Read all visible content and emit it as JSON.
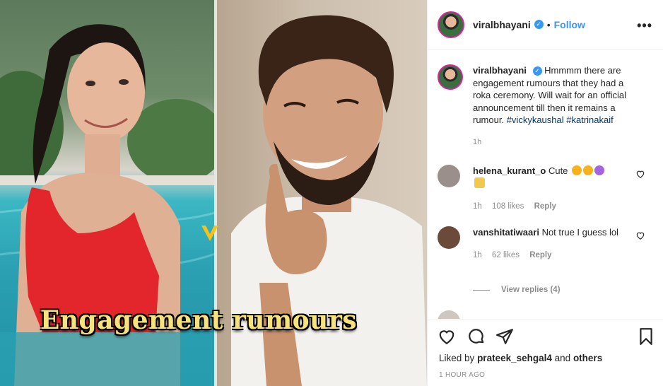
{
  "media": {
    "overlay_text": "Engagement rumours"
  },
  "header": {
    "username": "viralbhayani",
    "separator": "•",
    "follow_label": "Follow",
    "more_icon": "ellipsis-icon"
  },
  "caption": {
    "username": "viralbhayani",
    "text": "Hmmmm there are engagement rumours that they had a roka ceremony. Will wait for an official announcement till then it remains a rumour.",
    "hashtags": [
      "#vickykaushal",
      "#katrinakaif"
    ],
    "time": "1h"
  },
  "comments": [
    {
      "username": "helena_kurant_o",
      "text": "Cute",
      "time": "1h",
      "likes": "108 likes",
      "reply_label": "Reply",
      "avatar_color": "#9a8f8a"
    },
    {
      "username": "vanshitatiwaari",
      "text": "Not true I guess lol",
      "time": "1h",
      "likes": "62 likes",
      "reply_label": "Reply",
      "avatar_color": "#6b4a3a"
    }
  ],
  "view_replies": "View replies (4)",
  "actions": {
    "icons": [
      "heart-icon",
      "comment-icon",
      "share-icon",
      "bookmark-icon"
    ]
  },
  "liked_by": {
    "prefix": "Liked by",
    "user": "prateek_sehgal4",
    "and": "and",
    "others": "others"
  },
  "post_time": "1 HOUR AGO",
  "colors": {
    "link_blue": "#3897f0",
    "caption_text": "#f7e37a",
    "muted": "#8e8e8e"
  }
}
